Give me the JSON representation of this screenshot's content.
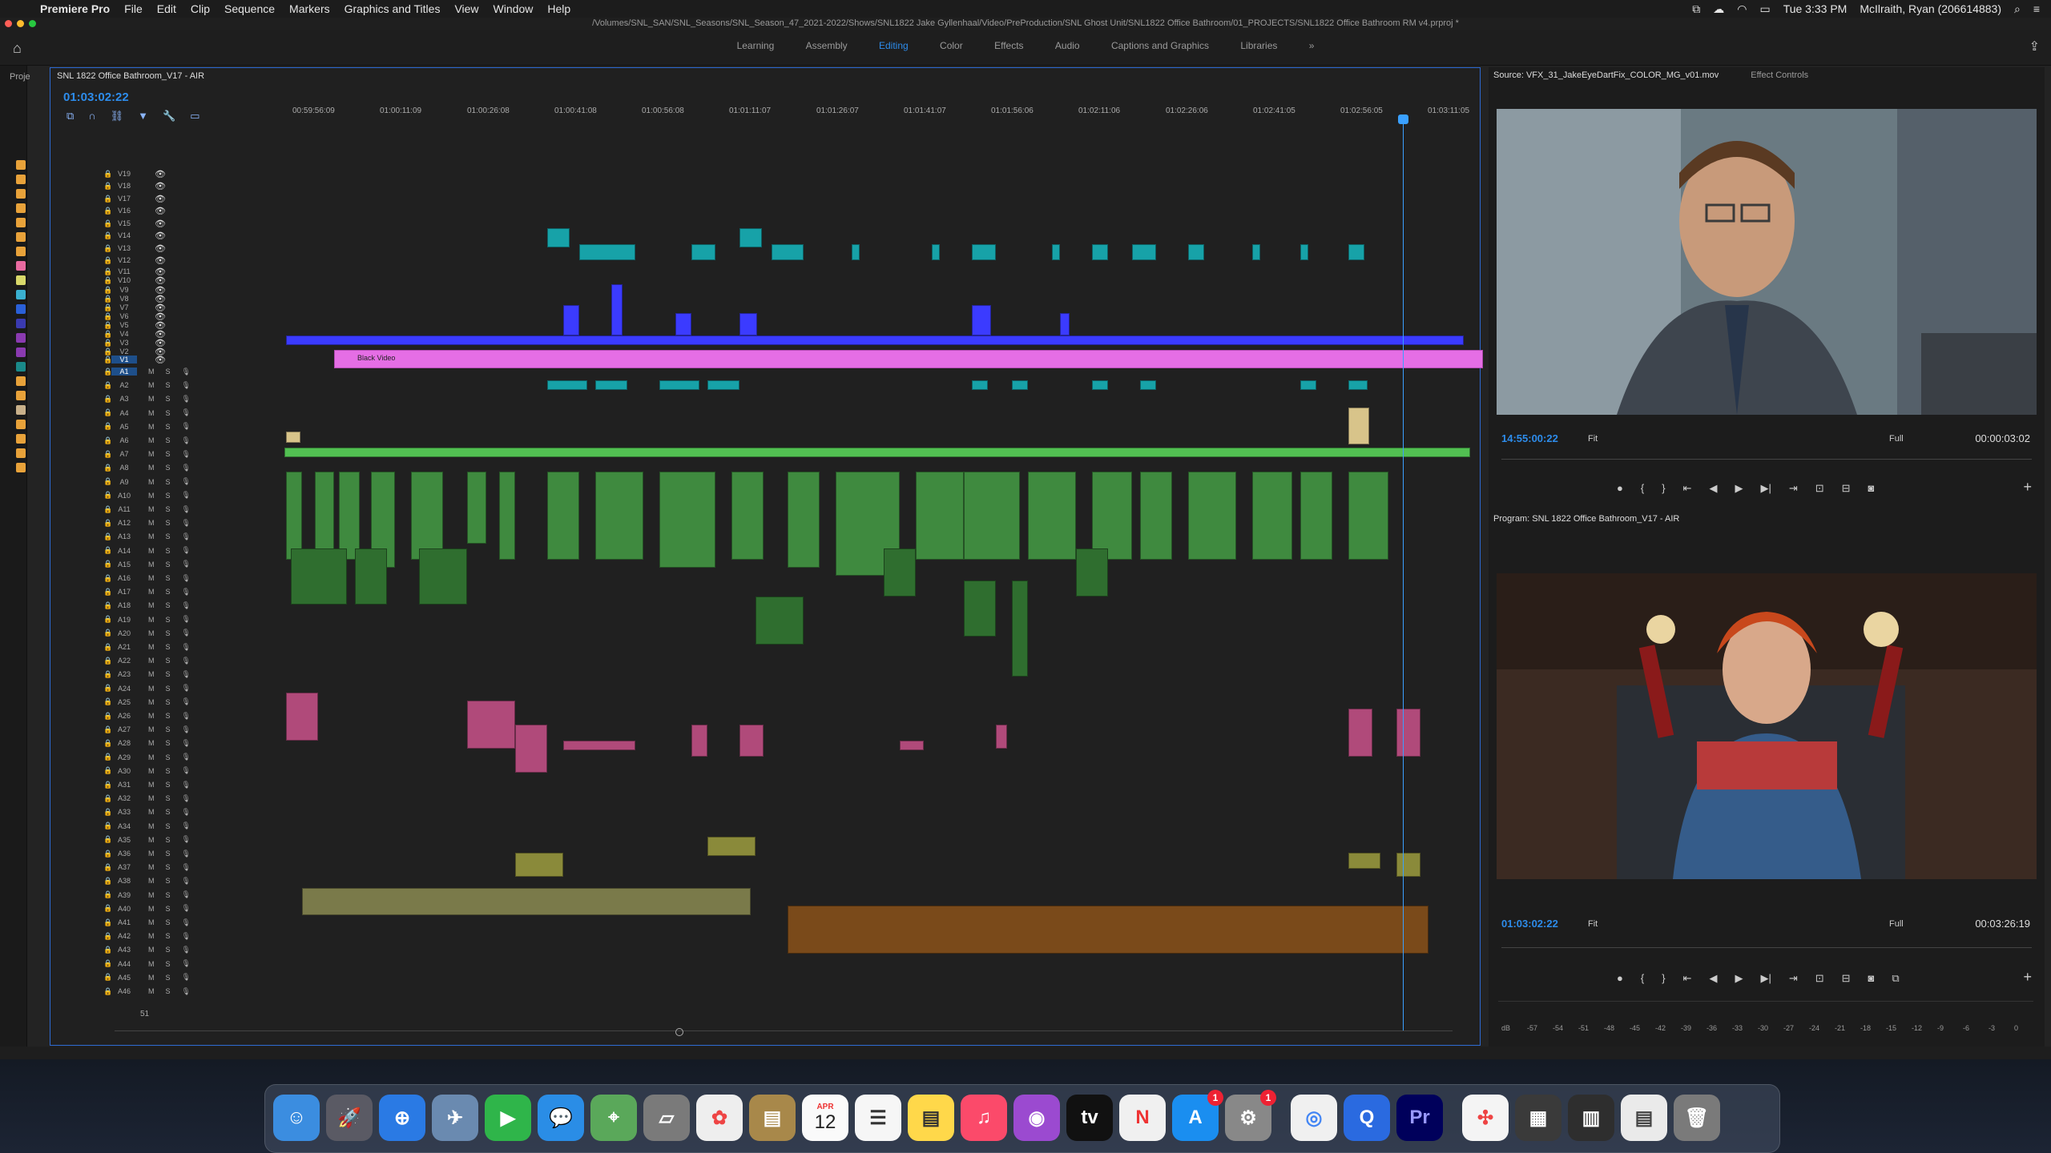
{
  "menubar": {
    "app_name": "Premiere Pro",
    "menus": [
      "File",
      "Edit",
      "Clip",
      "Sequence",
      "Markers",
      "Graphics and Titles",
      "View",
      "Window",
      "Help"
    ],
    "clock": "Tue 3:33 PM",
    "user": "McIlraith, Ryan (206614883)"
  },
  "titlebar": {
    "path": "/Volumes/SNL_SAN/SNL_Seasons/SNL_Season_47_2021-2022/Shows/SNL1822 Jake Gyllenhaal/Video/PreProduction/SNL Ghost Unit/SNL1822 Office Bathroom/01_PROJECTS/SNL1822 Office Bathroom RM v4.prproj *"
  },
  "workspaces": {
    "tabs": [
      "Learning",
      "Assembly",
      "Editing",
      "Color",
      "Effects",
      "Audio",
      "Captions and Graphics",
      "Libraries"
    ],
    "active": "Editing",
    "more": "»"
  },
  "project_panel": {
    "label": "Proje"
  },
  "timeline": {
    "tab_label": "SNL 1822 Office Bathroom_V17 - AIR",
    "timecode": "01:03:02:22",
    "ruler": [
      "00:59:56:09",
      "01:00:11:09",
      "01:00:26:08",
      "01:00:41:08",
      "01:00:56:08",
      "01:01:11:07",
      "01:01:26:07",
      "01:01:41:07",
      "01:01:56:06",
      "01:02:11:06",
      "01:02:26:06",
      "01:02:41:05",
      "01:02:56:05",
      "01:03:11:05"
    ],
    "video_tracks": [
      "V19",
      "V18",
      "V17",
      "V16",
      "V15",
      "V14",
      "V13",
      "V12",
      "V11",
      "V10",
      "V9",
      "V8",
      "V7",
      "V6",
      "V5",
      "V4",
      "V3",
      "V2",
      "V1"
    ],
    "audio_tracks": [
      "A1",
      "A2",
      "A3",
      "A4",
      "A5",
      "A6",
      "A7",
      "A8",
      "A9",
      "A10",
      "A11",
      "A12",
      "A13",
      "A14",
      "A15",
      "A16",
      "A17",
      "A18",
      "A19",
      "A20",
      "A21",
      "A22",
      "A23",
      "A24",
      "A25",
      "A26",
      "A27",
      "A28",
      "A29",
      "A30",
      "A31",
      "A32",
      "A33",
      "A34",
      "A35",
      "A36",
      "A37",
      "A38",
      "A39",
      "A40",
      "A41",
      "A42",
      "A43",
      "A44",
      "A45",
      "A46"
    ],
    "black_video_label": "Black Video",
    "mute_label": "M",
    "solo_label": "S",
    "footer_value": "51"
  },
  "source_monitor": {
    "tab_label": "Source: VFX_31_JakeEyeDartFix_COLOR_MG_v01.mov",
    "effect_controls": "Effect Controls",
    "timecode_in": "14:55:00:22",
    "fit": "Fit",
    "quality": "Full",
    "duration": "00:00:03:02"
  },
  "program_monitor": {
    "tab_label": "Program: SNL 1822 Office Bathroom_V17 - AIR",
    "timecode_in": "01:03:02:22",
    "fit": "Fit",
    "quality": "Full",
    "duration": "00:03:26:19",
    "meter_labels": [
      "dB",
      "-57",
      "-54",
      "-51",
      "-48",
      "-45",
      "-42",
      "-39",
      "-36",
      "-33",
      "-30",
      "-27",
      "-24",
      "-21",
      "-18",
      "-15",
      "-12",
      "-9",
      "-6",
      "-3",
      "0"
    ]
  },
  "dock": {
    "calendar_month": "APR",
    "calendar_day": "12",
    "appstore_badge": "1",
    "settings_badge": "1",
    "premiere_label": "Pr"
  },
  "colors": {
    "accent": "#2d8ceb",
    "video_teal": "#17a2a8",
    "video_blue": "#3b3bff",
    "black_video_pink": "#e56ee5",
    "audio_green": "#3f8a3f",
    "audio_pink": "#b04a7a",
    "audio_olive": "#8a8a3a",
    "audio_orange": "#7a4a1a"
  }
}
